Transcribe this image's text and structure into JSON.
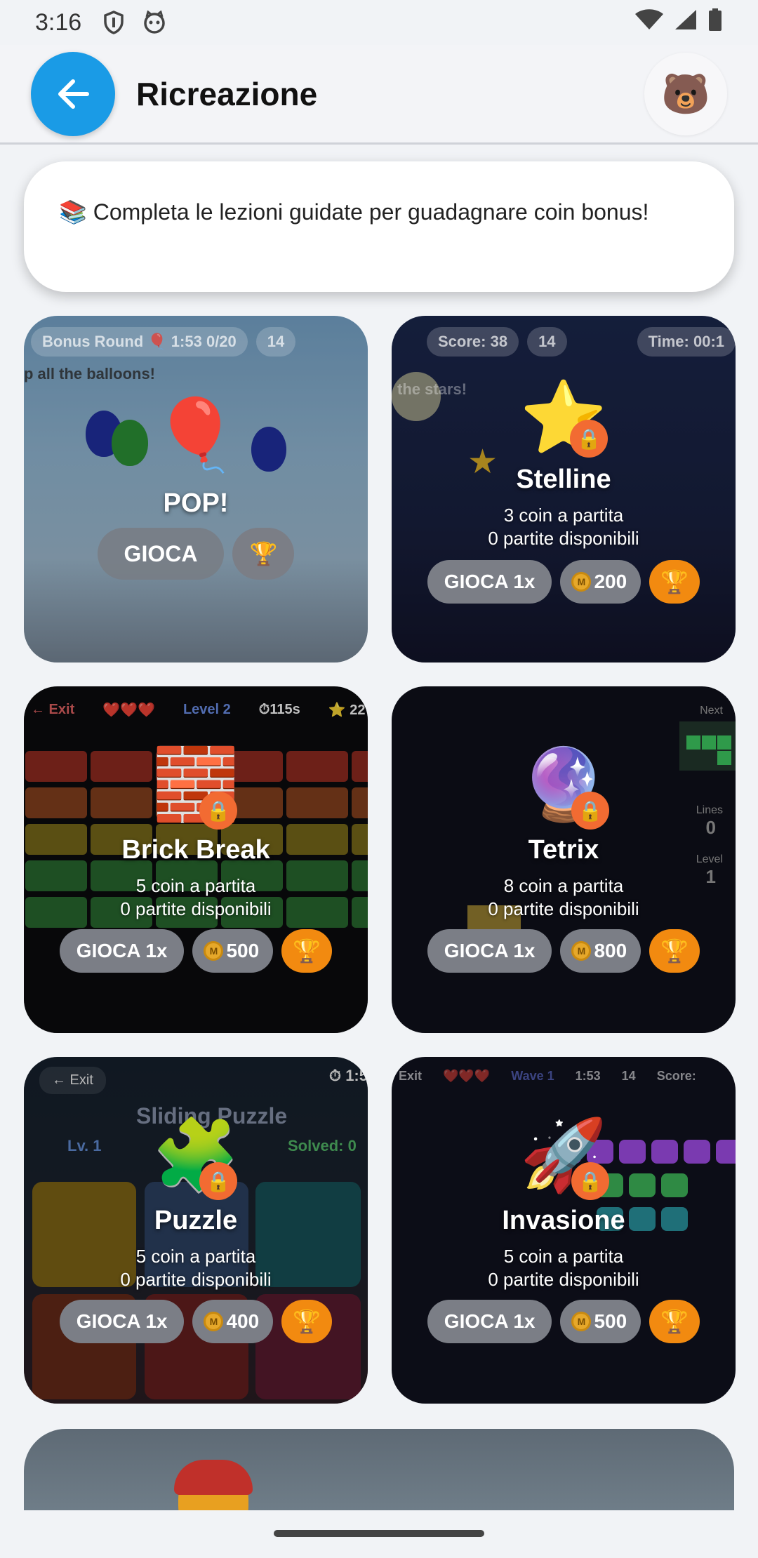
{
  "status_bar": {
    "time": "3:16"
  },
  "app_bar": {
    "title": "Ricreazione",
    "avatar_emoji": "🐻"
  },
  "banner": {
    "text": "📚 Completa le lezioni guidate per guadagnare coin bonus!"
  },
  "games": [
    {
      "name": "POP!",
      "play_label": "GIOCA",
      "hud": [
        "Bonus Round 🎈 1:53 0/20",
        "14"
      ],
      "hint": "p all the balloons!"
    },
    {
      "name": "Stelline",
      "cost": "3 coin a partita",
      "available": "0 partite disponibili",
      "play_label": "GIOCA 1x",
      "price": "200",
      "hud": [
        "Score: 38",
        "14",
        "Time: 00:1"
      ],
      "hint": "the stars!"
    },
    {
      "name": "Brick Break",
      "cost": "5 coin a partita",
      "available": "0 partite disponibili",
      "play_label": "GIOCA 1x",
      "price": "500",
      "hud": [
        "← Exit",
        "❤️❤️❤️",
        "Level 2",
        "⏱115s",
        "⭐ 22"
      ]
    },
    {
      "name": "Tetrix",
      "cost": "8 coin a partita",
      "available": "0 partite disponibili",
      "play_label": "GIOCA 1x",
      "price": "800",
      "hud": [
        "Next",
        "Lines",
        "0",
        "Level",
        "1"
      ]
    },
    {
      "name": "Puzzle",
      "cost": "5 coin a partita",
      "available": "0 partite disponibili",
      "play_label": "GIOCA 1x",
      "price": "400",
      "hud": [
        "← Exit",
        "⏱ 1:5",
        "Sliding Puzzle",
        "Lv. 1",
        "Solved: 0"
      ]
    },
    {
      "name": "Invasione",
      "cost": "5 coin a partita",
      "available": "0 partite disponibili",
      "play_label": "GIOCA 1x",
      "price": "500",
      "hud": [
        "Exit",
        "❤️❤️❤️",
        "Wave 1",
        "1:53",
        "14",
        "Score:"
      ]
    }
  ],
  "colors": {
    "accent_blue": "#1a9be6",
    "trophy_orange": "#f28a10",
    "lock_orange": "#f26b32",
    "button_grey": "#7b7e86"
  },
  "icons": {
    "pop": "balloon-icon",
    "stelline": "star-icon",
    "brick": "brick-icon",
    "tetrix": "crystal-ball-icon",
    "puzzle": "puzzle-piece-icon",
    "invasione": "rocket-icon"
  }
}
